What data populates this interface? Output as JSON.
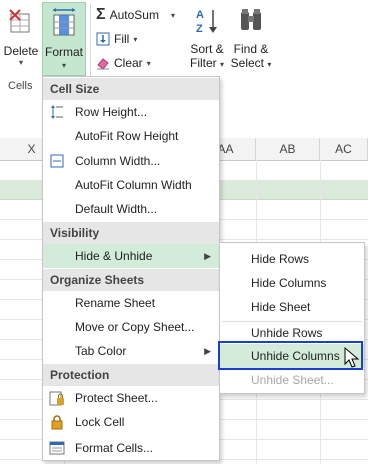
{
  "ribbon": {
    "delete_label": "Delete",
    "cells_group_label": "Cells",
    "format_label": "Format",
    "autosum_label": "AutoSum",
    "fill_label": "Fill",
    "clear_label": "Clear",
    "sort_label_1": "Sort &",
    "sort_label_2": "Filter",
    "find_label_1": "Find &",
    "find_label_2": "Select"
  },
  "columns": [
    "X",
    "AA",
    "AB",
    "AC"
  ],
  "menu": {
    "cell_size_header": "Cell Size",
    "row_height": "Row Height...",
    "autofit_row_height": "AutoFit Row Height",
    "column_width": "Column Width...",
    "autofit_column_width": "AutoFit Column Width",
    "default_width": "Default Width...",
    "visibility_header": "Visibility",
    "hide_unhide": "Hide & Unhide",
    "organize_header": "Organize Sheets",
    "rename_sheet": "Rename Sheet",
    "move_copy_sheet": "Move or Copy Sheet...",
    "tab_color": "Tab Color",
    "protection_header": "Protection",
    "protect_sheet": "Protect Sheet...",
    "lock_cell": "Lock Cell",
    "format_cells": "Format Cells..."
  },
  "submenu": {
    "hide_rows": "Hide Rows",
    "hide_columns": "Hide Columns",
    "hide_sheet": "Hide Sheet",
    "unhide_rows": "Unhide Rows",
    "unhide_columns": "Unhide Columns",
    "unhide_sheet": "Unhide Sheet..."
  },
  "colors": {
    "accent_green": "#d3ecd9",
    "selected_row": "#dceadb",
    "focus_blue": "#1a3fcf"
  }
}
